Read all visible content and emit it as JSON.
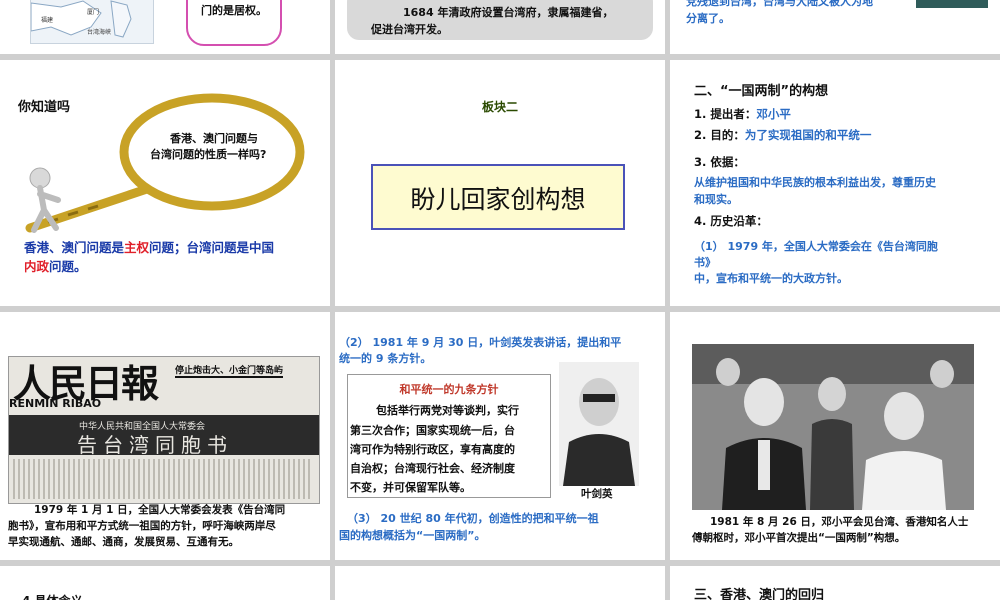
{
  "slides": {
    "s1": {
      "map_labels": [
        "厦门",
        "福建",
        "台湾海峡"
      ],
      "bubble_text": "门的是居权。"
    },
    "s2": {
      "caption_line1": "1684 年清政府设置台湾府，隶属福建省，",
      "caption_line2": "促进台湾开发。"
    },
    "s3": {
      "text_line1": "党残退到台湾，台湾与大陆又被人为地",
      "text_line2": "分离了。"
    },
    "s4": {
      "title": "你知道吗",
      "question_line1": "香港、澳门问题与",
      "question_line2": "台湾问题的性质一样吗?",
      "answer_p1": "香港、澳门问题是",
      "answer_p2": "主权",
      "answer_p3": "问题；台湾问题是中国",
      "answer_p4": "内政",
      "answer_p5": "问题。"
    },
    "s5": {
      "section": "板块二",
      "box_title": "盼儿回家创构想"
    },
    "s6": {
      "heading": "二、“一国两制”的构想",
      "item1_label": "1. 提出者：",
      "item1_value": "邓小平",
      "item2_label": "2. 目的：",
      "item2_value": "为了实现祖国的和平统一",
      "item3_label": "3. 依据：",
      "item3_value_line1": "从维护祖国和中华民族的根本利益出发，尊重历史",
      "item3_value_line2": "和现实。",
      "item4_label": "4. 历史沿革：",
      "item4_value_line1": "（1） 1979 年，全国人大常委会在《告台湾同胞",
      "item4_value_line2": "书》",
      "item4_value_line3": "中，宣布和平统一的大政方针。"
    },
    "s7": {
      "newspaper_name": "人民日報",
      "newspaper_pinyin": "RENMIN RIBAO",
      "newspaper_headline": "停止炮击大、小金门等岛屿",
      "newspaper_subhead": "中华人民共和国全国人大常委会",
      "newspaper_big": "告台湾同胞书",
      "caption_line1": "1979 年 1 月 1 日，全国人大常委会发表《告台湾同",
      "caption_line2": "胞书》，宣布用和平方式统一祖国的方针，呼吁海峡两岸尽",
      "caption_line3": "早实现通航、通邮、通商，发展贸易、互通有无。"
    },
    "s8": {
      "intro_line1": "（2） 1981 年 9 月 30 日，叶剑英发表讲话，提出和平",
      "intro_line2": "统一的 9 条方针。",
      "box_title": "和平统一的九条方针",
      "box_lines": [
        "包括举行两党对等谈判，实行",
        "第三次合作；国家实现统一后，台",
        "湾可作为特别行政区，享有高度的",
        "自治权；台湾现行社会、经济制度",
        "不变，并可保留军队等。"
      ],
      "portrait_caption": "叶剑英",
      "outro_line1": "（3） 20 世纪 80 年代初，创造性的把和平统一祖",
      "outro_line2": "国的构想概括为“一国两制”。"
    },
    "s9": {
      "caption_line1": "1981 年 8 月 26 日，邓小平会见台湾、香港知名人士",
      "caption_line2": "傅朝枢时，邓小平首次提出“一国两制”构想。"
    },
    "s10": {
      "text": "4 具体含义"
    },
    "s12": {
      "heading": "三、香港、澳门的回归"
    }
  }
}
